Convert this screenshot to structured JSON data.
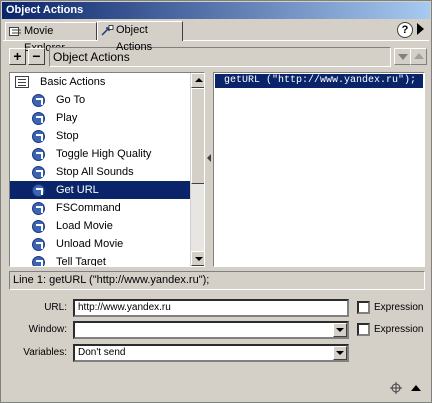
{
  "window": {
    "title": "Object Actions"
  },
  "tabs": [
    {
      "label": "Movie Explorer",
      "icon": "movie-explorer-icon",
      "active": false
    },
    {
      "label": "Object Actions",
      "icon": "object-actions-icon",
      "active": true
    }
  ],
  "toolbar": {
    "add_label": "+",
    "remove_label": "−",
    "title": "Object Actions",
    "help_label": "?"
  },
  "actions_list": {
    "header": "Basic Actions",
    "items": [
      {
        "label": "Go To",
        "selected": false
      },
      {
        "label": "Play",
        "selected": false
      },
      {
        "label": "Stop",
        "selected": false
      },
      {
        "label": "Toggle High Quality",
        "selected": false
      },
      {
        "label": "Stop All Sounds",
        "selected": false
      },
      {
        "label": "Get URL",
        "selected": true
      },
      {
        "label": "FSCommand",
        "selected": false
      },
      {
        "label": "Load Movie",
        "selected": false
      },
      {
        "label": "Unload Movie",
        "selected": false
      },
      {
        "label": "Tell Target",
        "selected": false
      }
    ]
  },
  "script": {
    "lines": [
      "getURL (\"http://www.yandex.ru\");"
    ]
  },
  "status_line": "Line 1: getURL (\"http://www.yandex.ru\");",
  "params": {
    "url_label": "URL:",
    "url_value": "http://www.yandex.ru",
    "window_label": "Window:",
    "window_value": "",
    "variables_label": "Variables:",
    "variables_value": "Don't send",
    "expression_label": "Expression"
  },
  "colors": {
    "selection": "#0a246a",
    "face": "#d4d0c8"
  }
}
